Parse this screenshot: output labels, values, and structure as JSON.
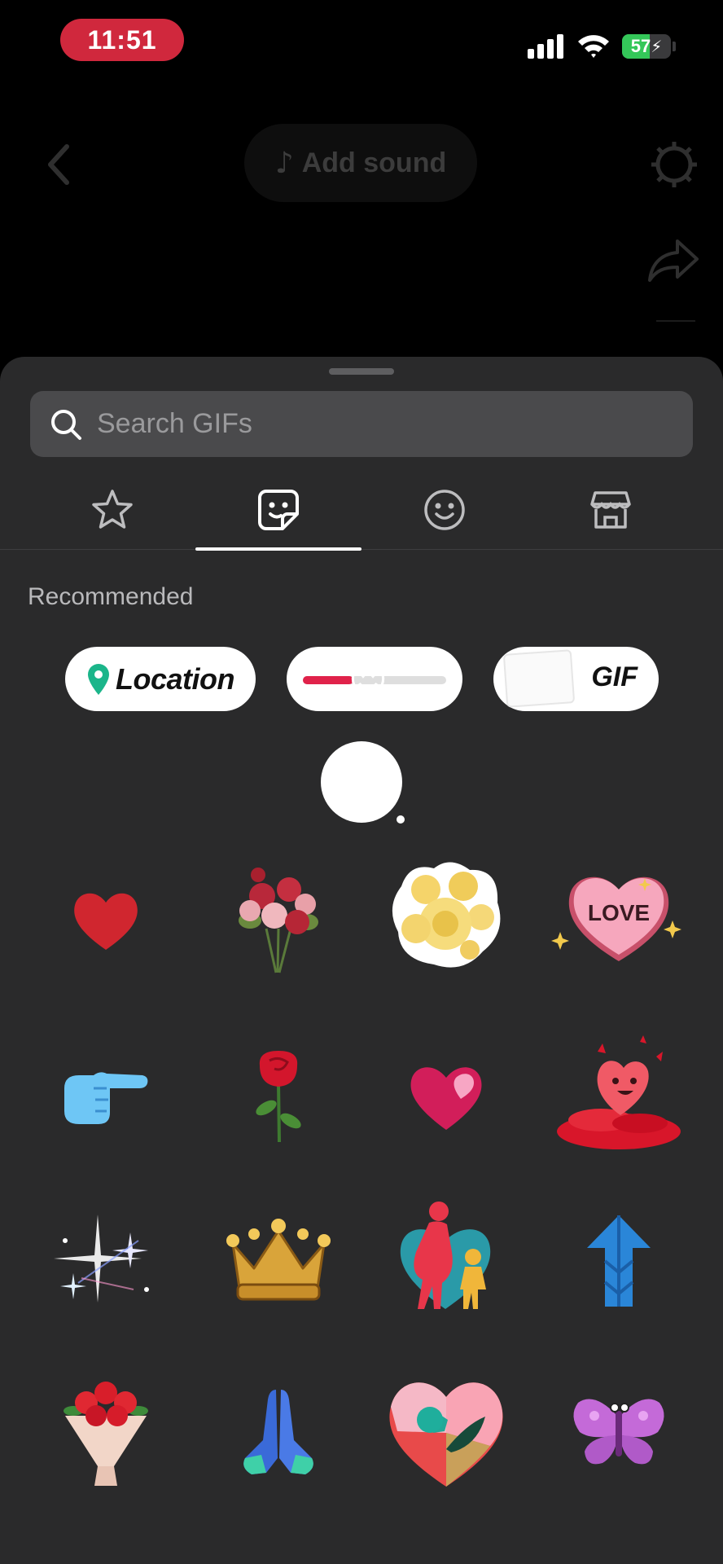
{
  "status_bar": {
    "time": "11:51",
    "battery_percent": "57",
    "battery_level": 0.57,
    "icons": [
      "signal-icon",
      "wifi-icon",
      "battery-charging-icon"
    ],
    "accent_color": "#d0283d"
  },
  "top_bar": {
    "add_sound_label": "Add sound",
    "icons": [
      "back-chevron-icon",
      "music-note-icon",
      "settings-icon",
      "share-icon"
    ]
  },
  "sheet": {
    "search": {
      "placeholder": "Search GIFs",
      "value": ""
    },
    "tabs": [
      {
        "icon": "star-icon",
        "active": false
      },
      {
        "icon": "sticker-icon",
        "active": true
      },
      {
        "icon": "smiley-icon",
        "active": false
      },
      {
        "icon": "store-icon",
        "active": false
      }
    ],
    "section_title": "Recommended",
    "recommended": {
      "location_chip": "Location",
      "slider_chip_emoji": "😍",
      "slider_level": 0.35,
      "gif_chip": "GIF",
      "emoji_reaction": "😍"
    },
    "stickers": [
      [
        "red-heart-sticker",
        "rose-bouquet-sticker",
        "yellow-flowers-sticker",
        "love-heart-sticker"
      ],
      [
        "pointing-hand-sticker",
        "single-rose-sticker",
        "pink-heart-sticker",
        "heart-character-sticker"
      ],
      [
        "sparkles-sticker",
        "gold-crown-sticker",
        "mother-child-sticker",
        "blue-arrow-sticker"
      ],
      [
        "red-bouquet-sticker",
        "praying-hands-sticker",
        "flower-heart-sticker",
        "purple-butterfly-sticker"
      ]
    ],
    "love_sticker_text": "LOVE"
  }
}
